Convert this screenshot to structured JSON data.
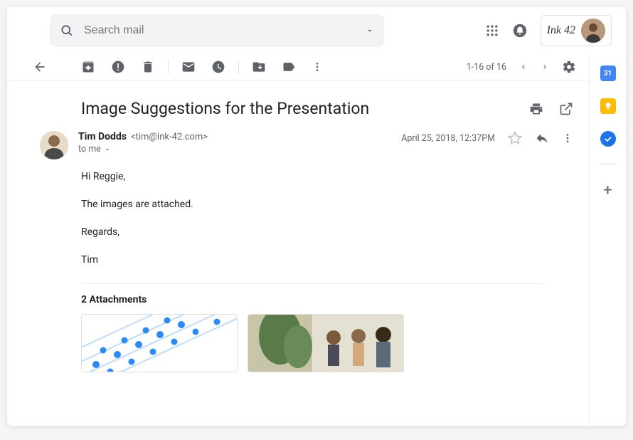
{
  "header": {
    "search_placeholder": "Search mail",
    "brand": "Ink 42"
  },
  "toolbar": {
    "pagination": "1-16 of 16"
  },
  "subject": "Image Suggestions for the Presentation",
  "message": {
    "sender_name": "Tim Dodds",
    "sender_email": "<tim@ink-42.com>",
    "to_line": "to me",
    "timestamp": "April 25, 2018, 12:37PM",
    "body": {
      "p1": "Hi Reggie,",
      "p2": "The images are attached.",
      "p3": "Regards,",
      "p4": "Tim"
    }
  },
  "attachments": {
    "title": "2 Attachments"
  },
  "sidepanel": {
    "calendar_day": "31"
  }
}
